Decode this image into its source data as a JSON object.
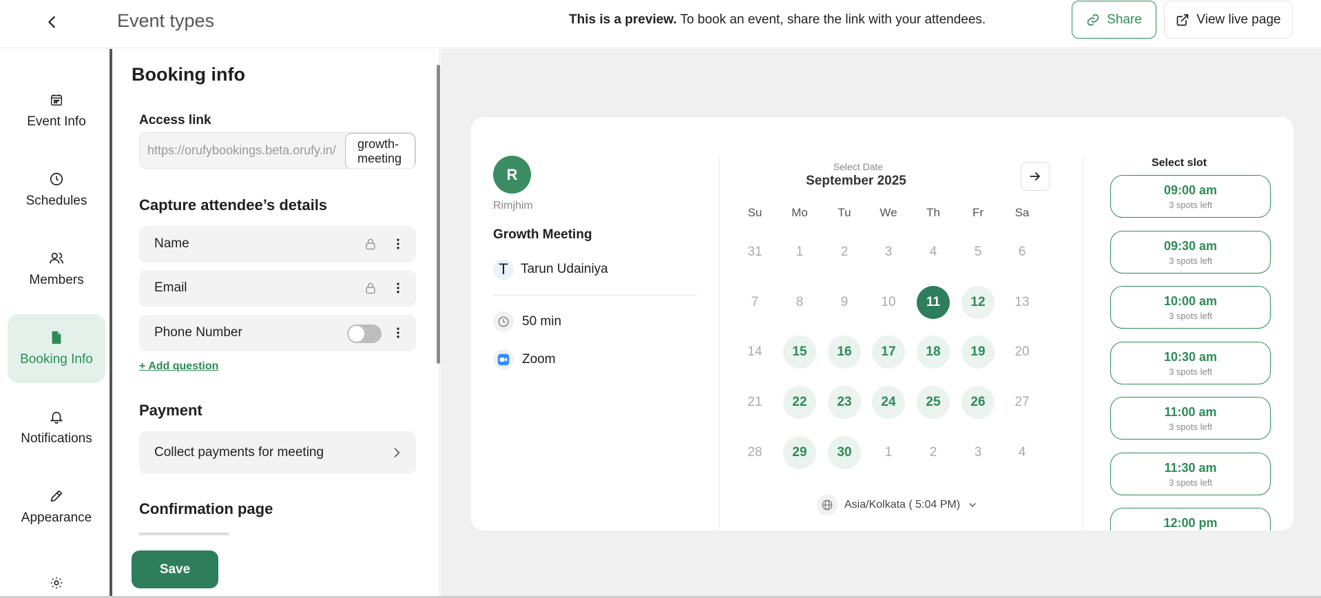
{
  "header": {
    "title": "Event types",
    "preview_bold": "This is a preview.",
    "preview_rest": " To book an event, share the link with your attendees.",
    "share_label": "Share",
    "live_label": "View live page"
  },
  "nav": {
    "items": [
      {
        "label": "Event Info",
        "icon": "calendar-icon"
      },
      {
        "label": "Schedules",
        "icon": "clock-icon"
      },
      {
        "label": "Members",
        "icon": "users-icon"
      },
      {
        "label": "Booking Info",
        "icon": "file-icon",
        "active": true
      },
      {
        "label": "Notifications",
        "icon": "bell-icon"
      },
      {
        "label": "Appearance",
        "icon": "pencil-icon"
      },
      {
        "label": "",
        "icon": "gear-icon"
      }
    ]
  },
  "booking": {
    "title": "Booking info",
    "access_label": "Access link",
    "access_url": "https://orufybookings.beta.orufy.in/",
    "access_slug": "growth-meeting",
    "capture_title": "Capture attendee’s details",
    "fields": [
      {
        "name": "Name",
        "control": "lock"
      },
      {
        "name": "Email",
        "control": "lock"
      },
      {
        "name": "Phone Number",
        "control": "toggle-off"
      }
    ],
    "add_question": "+ Add question",
    "payment_title": "Payment",
    "payment_row": "Collect payments for meeting",
    "confirmation_title": "Confirmation page",
    "save_label": "Save"
  },
  "preview": {
    "host_initial": "R",
    "host_name": "Rimjhim",
    "event_title": "Growth Meeting",
    "member_initial": "T",
    "member_name": "Tarun Udainiya",
    "duration": "50 min",
    "location": "Zoom",
    "calendar": {
      "subtitle": "Select Date",
      "month": "September 2025",
      "weekdays": [
        "Su",
        "Mo",
        "Tu",
        "We",
        "Th",
        "Fr",
        "Sa"
      ],
      "weeks": [
        [
          {
            "d": "31",
            "s": "muted"
          },
          {
            "d": "1",
            "s": "muted"
          },
          {
            "d": "2",
            "s": "muted"
          },
          {
            "d": "3",
            "s": "muted"
          },
          {
            "d": "4",
            "s": "muted"
          },
          {
            "d": "5",
            "s": "muted"
          },
          {
            "d": "6",
            "s": "muted"
          }
        ],
        [
          {
            "d": "7",
            "s": "muted"
          },
          {
            "d": "8",
            "s": "muted"
          },
          {
            "d": "9",
            "s": "muted"
          },
          {
            "d": "10",
            "s": "muted"
          },
          {
            "d": "11",
            "s": "sel"
          },
          {
            "d": "12",
            "s": "avail"
          },
          {
            "d": "13",
            "s": "muted"
          }
        ],
        [
          {
            "d": "14",
            "s": "muted"
          },
          {
            "d": "15",
            "s": "avail"
          },
          {
            "d": "16",
            "s": "avail"
          },
          {
            "d": "17",
            "s": "avail"
          },
          {
            "d": "18",
            "s": "avail"
          },
          {
            "d": "19",
            "s": "avail"
          },
          {
            "d": "20",
            "s": "muted"
          }
        ],
        [
          {
            "d": "21",
            "s": "muted"
          },
          {
            "d": "22",
            "s": "avail"
          },
          {
            "d": "23",
            "s": "avail"
          },
          {
            "d": "24",
            "s": "avail"
          },
          {
            "d": "25",
            "s": "avail"
          },
          {
            "d": "26",
            "s": "avail"
          },
          {
            "d": "27",
            "s": "muted"
          }
        ],
        [
          {
            "d": "28",
            "s": "muted"
          },
          {
            "d": "29",
            "s": "avail"
          },
          {
            "d": "30",
            "s": "avail"
          },
          {
            "d": "1",
            "s": "muted"
          },
          {
            "d": "2",
            "s": "muted"
          },
          {
            "d": "3",
            "s": "muted"
          },
          {
            "d": "4",
            "s": "muted"
          }
        ]
      ]
    },
    "timezone": "Asia/Kolkata ( 5:04 PM)",
    "slot_title": "Select slot",
    "slots": [
      {
        "time": "09:00 am",
        "spots": "3 spots left"
      },
      {
        "time": "09:30 am",
        "spots": "3 spots left"
      },
      {
        "time": "10:00 am",
        "spots": "3 spots left"
      },
      {
        "time": "10:30 am",
        "spots": "3 spots left"
      },
      {
        "time": "11:00 am",
        "spots": "3 spots left"
      },
      {
        "time": "11:30 am",
        "spots": "3 spots left"
      },
      {
        "time": "12:00 pm",
        "spots": ""
      }
    ]
  },
  "colors": {
    "brand": "#2e8b57",
    "brand_dark": "#2e7d5b",
    "brand_light": "#eaf3ee"
  }
}
